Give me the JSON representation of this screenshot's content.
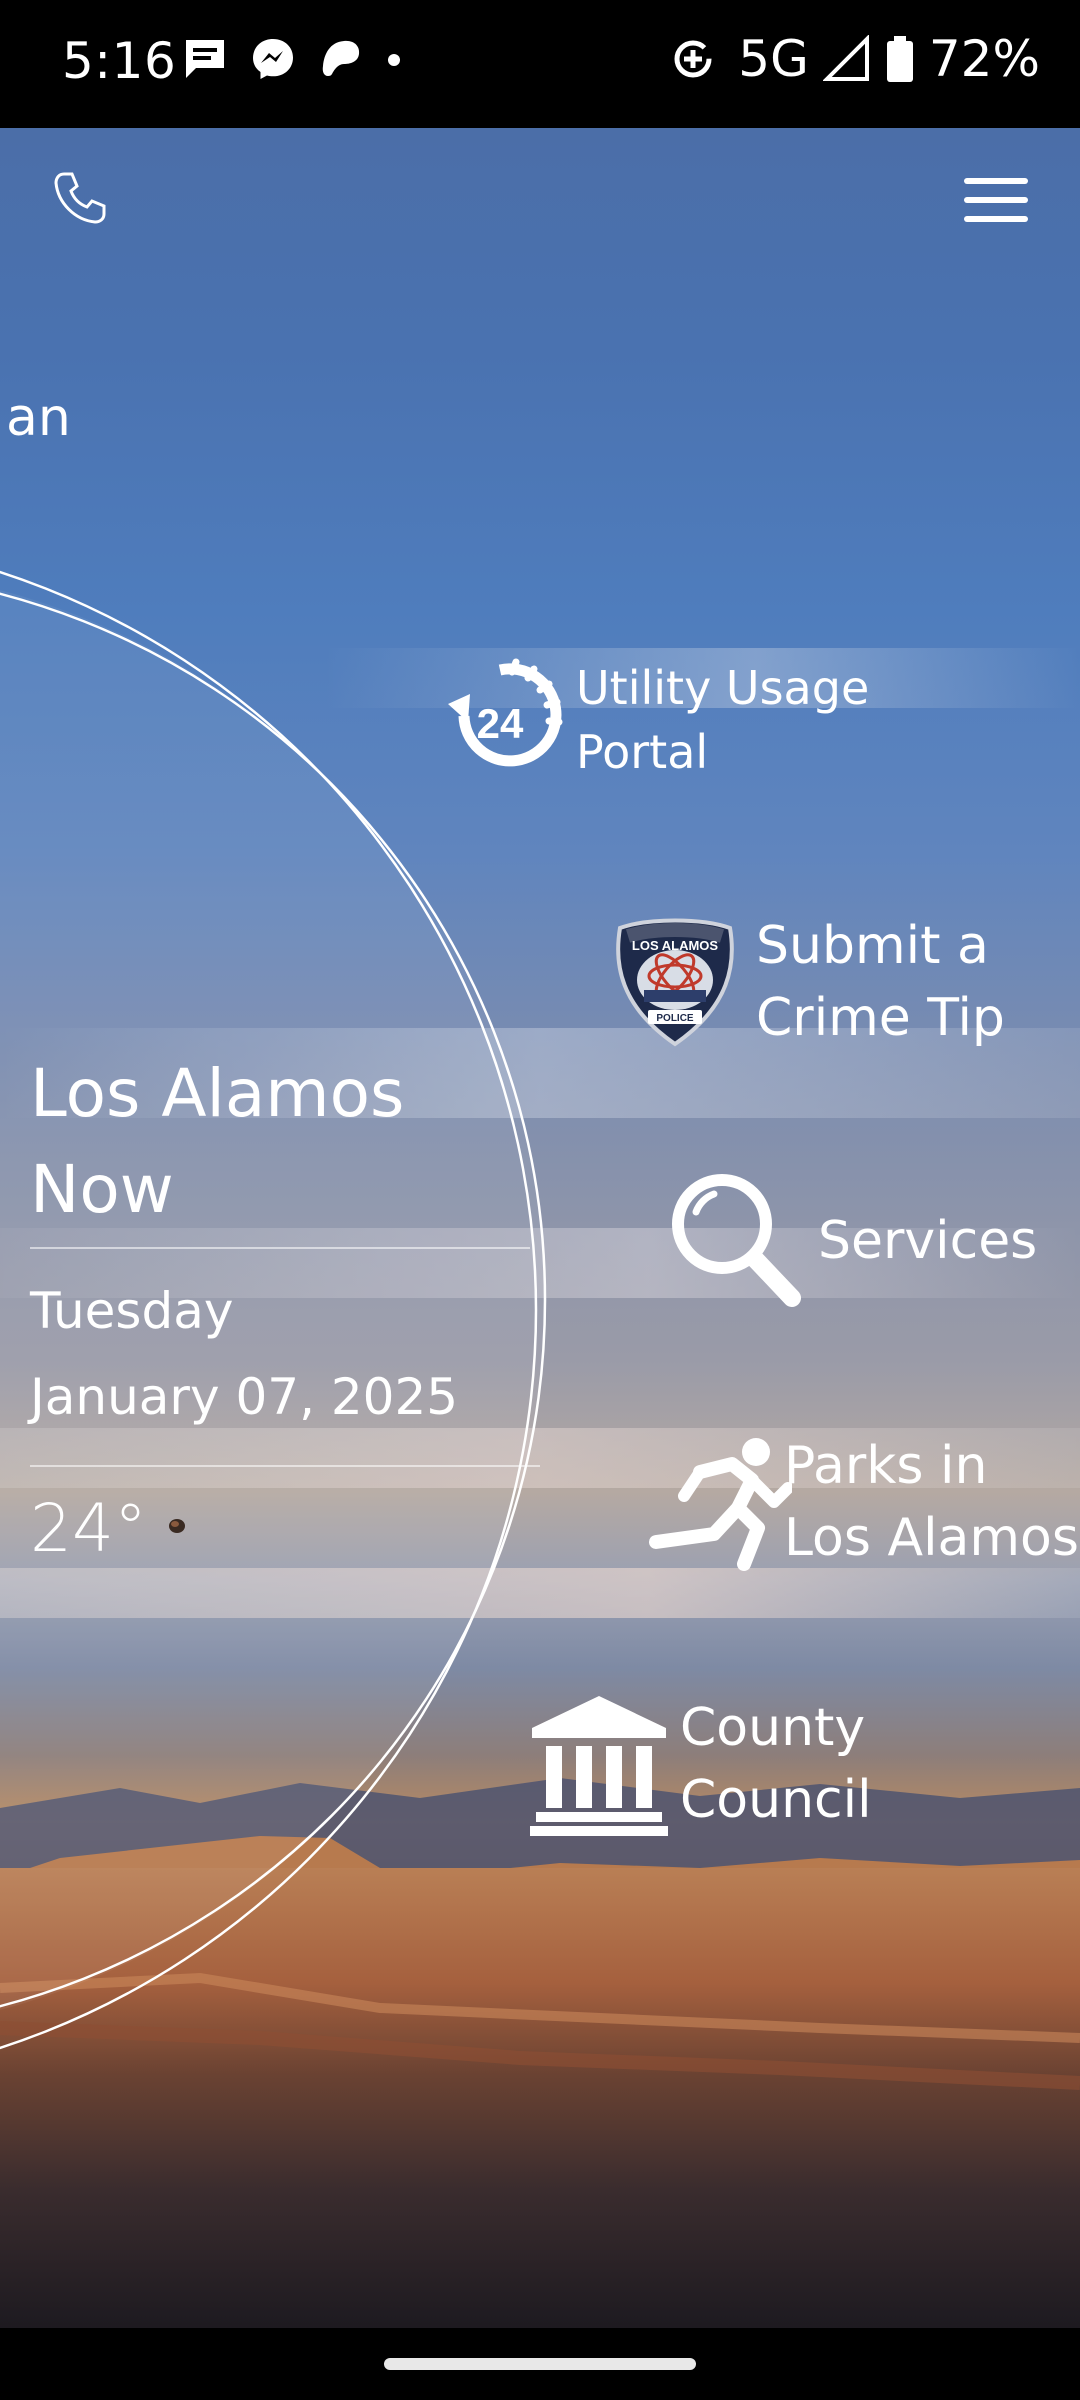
{
  "status_bar": {
    "time": "5:16",
    "network": "5G",
    "battery": "72%",
    "left_icons": [
      "message-icon",
      "messenger-icon",
      "chat-icon",
      "dot-icon"
    ],
    "right_icons": [
      "data-saver-icon",
      "signal-icon",
      "battery-icon"
    ]
  },
  "header": {
    "phone_icon": "phone-icon",
    "menu_icon": "hamburger-menu-icon",
    "partial_text": "an"
  },
  "info_panel": {
    "title": "Los Alamos Now",
    "day": "Tuesday",
    "date": "January 07, 2025",
    "temperature": "24°",
    "weather_icon": "moon-icon"
  },
  "quick_links": [
    {
      "label": "Utility Usage\nPortal",
      "icon": "24-hour-icon"
    },
    {
      "label": "Submit a\nCrime Tip",
      "icon": "police-badge-icon"
    },
    {
      "label": "Services",
      "icon": "search-icon"
    },
    {
      "label": "Parks in\nLos Alamos",
      "icon": "running-person-icon"
    },
    {
      "label": "County\nCouncil",
      "icon": "government-building-icon"
    }
  ],
  "badge": {
    "top_text": "LOS ALAMOS",
    "bottom_text": "POLICE"
  }
}
